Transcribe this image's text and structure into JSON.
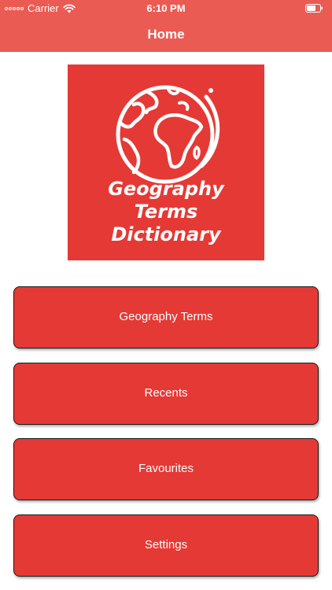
{
  "status_bar": {
    "carrier": "Carrier",
    "time": "6:10 PM",
    "wifi_icon": "wifi-icon",
    "battery_icon": "battery-icon"
  },
  "nav": {
    "title": "Home"
  },
  "logo": {
    "line1": "Geography",
    "line2": "Terms",
    "line3": "Dictionary",
    "icon": "globe-icon",
    "background_color": "#e53935"
  },
  "menu": {
    "items": [
      {
        "label": "Geography Terms"
      },
      {
        "label": "Recents"
      },
      {
        "label": "Favourites"
      },
      {
        "label": "Settings"
      }
    ]
  },
  "colors": {
    "nav_bar": "#ea5b54",
    "button": "#e53935",
    "button_text": "#ffffff"
  }
}
